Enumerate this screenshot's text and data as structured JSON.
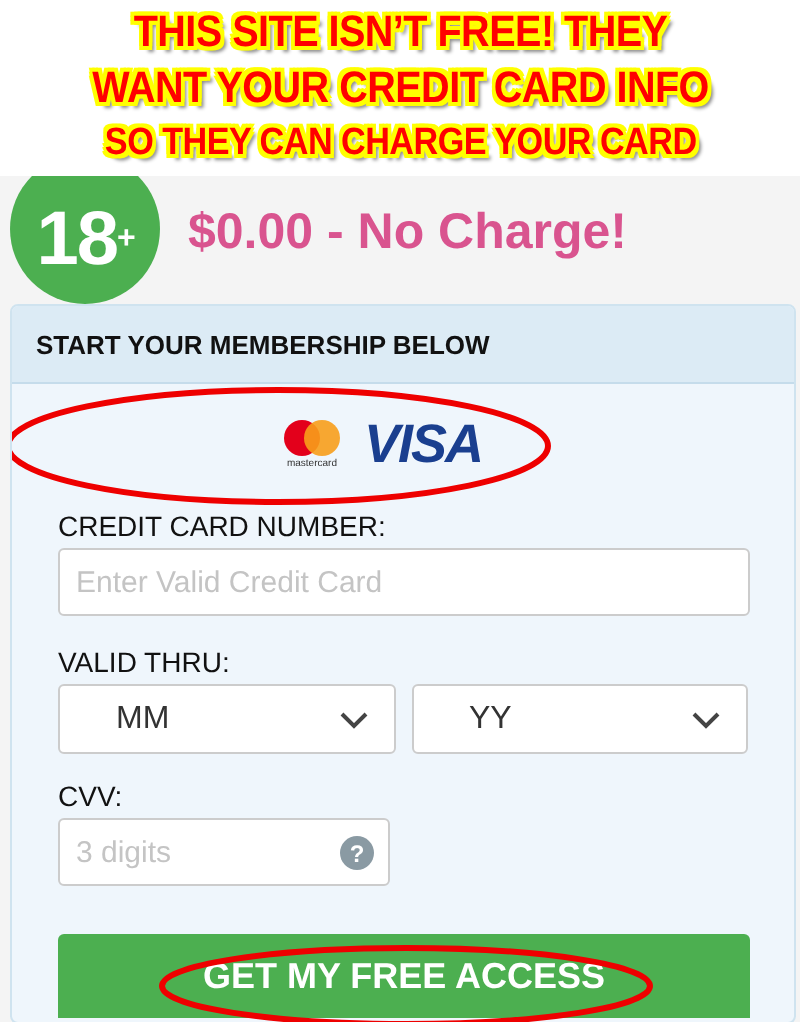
{
  "annotation": {
    "lines": [
      "THIS SITE ISN’T FREE! THEY",
      "WANT YOUR CREDIT CARD INFO",
      "SO THEY CAN CHARGE YOUR CARD"
    ]
  },
  "header": {
    "badge": "18$^{+}$",
    "price": "$0.00 - No Charge!"
  },
  "panel": {
    "title": "START YOUR MEMBERSHIP BELOW",
    "card_logos": [
      {
        "kind": "mastercard",
        "label": "mastercard"
      },
      {
        "kind": "visa",
        "label": "VISA"
      }
    ],
    "fields": [
      {
        "kind": "input",
        "label": "CREDIT CARD NUMBER:",
        "placeholder": "Enter Valid Credit Card"
      },
      {
        "kind": "selects",
        "label": "VALID THRU:",
        "options": [
          "MM",
          "YY"
        ]
      },
      {
        "kind": "cvv",
        "label": "CVV:",
        "placeholder": "3 digits",
        "help": "?"
      }
    ],
    "button": "GET MY FREE ACCESS"
  }
}
